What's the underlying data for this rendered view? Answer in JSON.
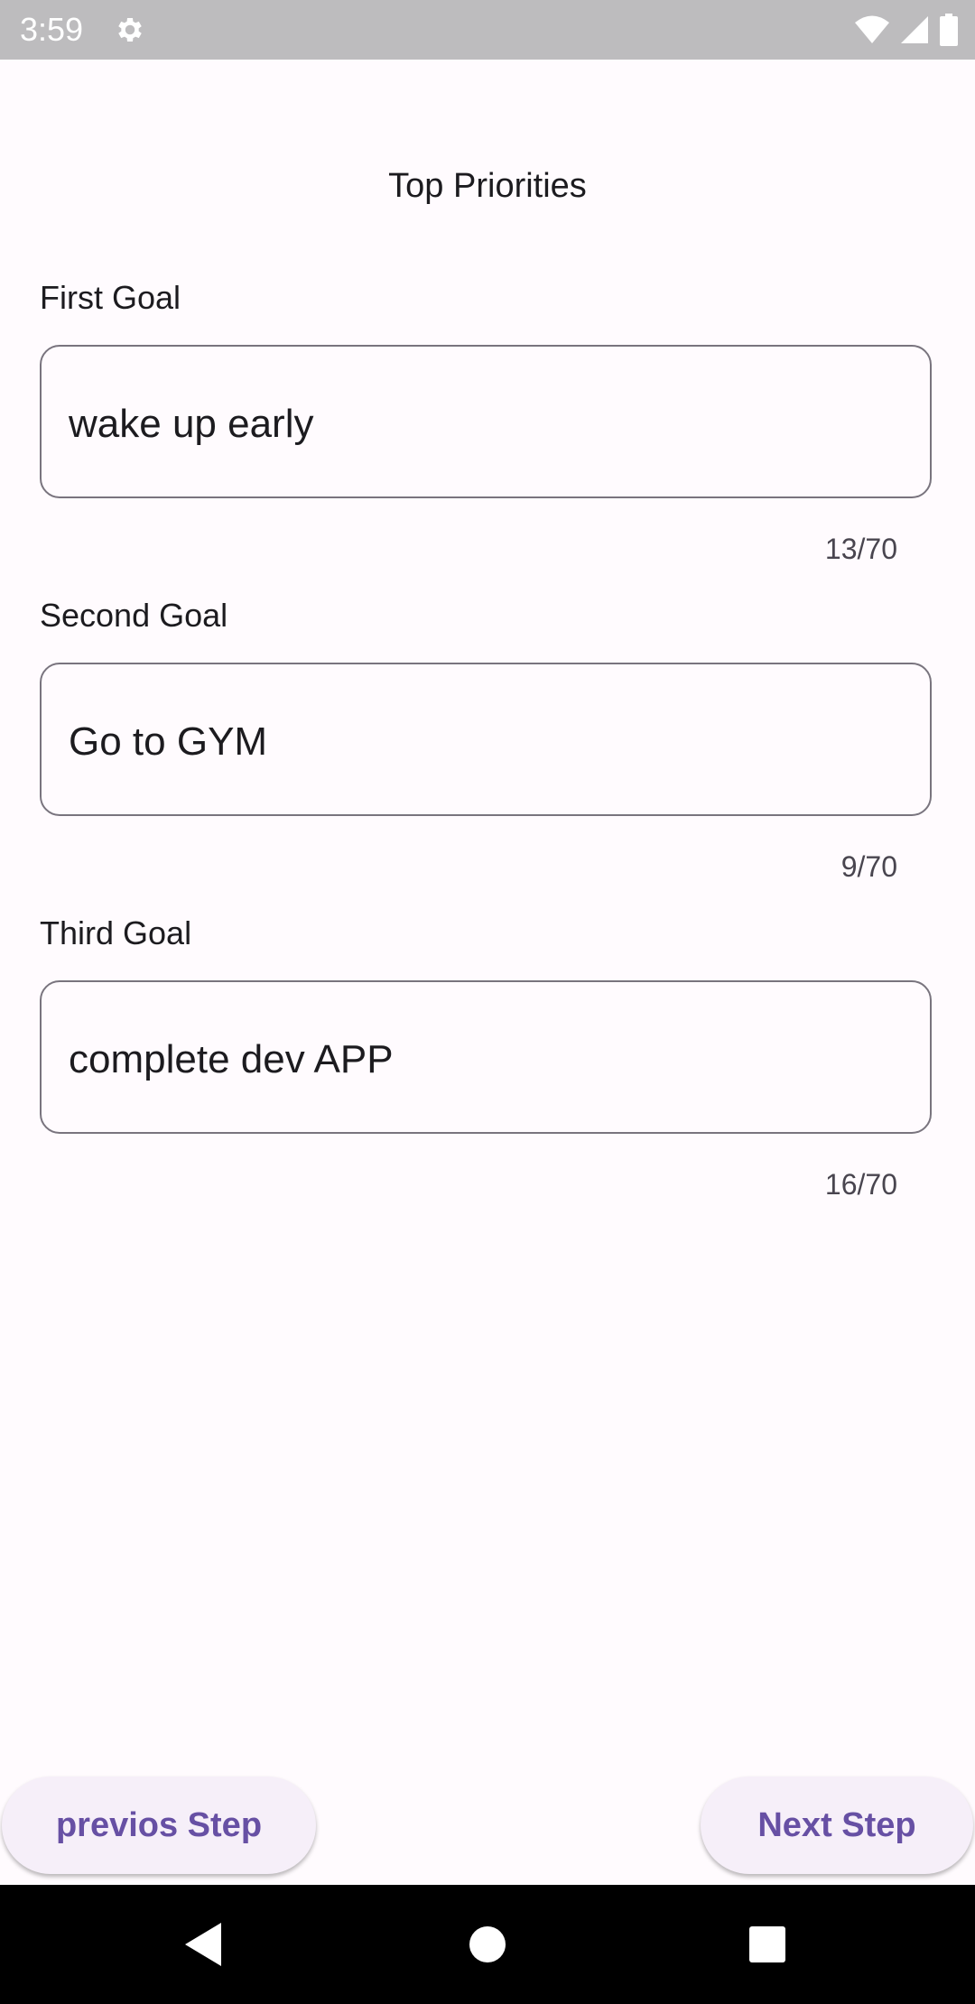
{
  "status_bar": {
    "time": "3:59",
    "icons": [
      "gear-icon",
      "wifi-icon",
      "signal-icon",
      "battery-icon"
    ]
  },
  "header": {
    "title": "Top Priorities"
  },
  "goals": [
    {
      "label": "First Goal",
      "value": "wake up early",
      "counter": "13/70"
    },
    {
      "label": "Second Goal",
      "value": "Go to GYM",
      "counter": "9/70"
    },
    {
      "label": "Third Goal",
      "value": "complete dev APP",
      "counter": "16/70"
    }
  ],
  "footer": {
    "prev_label": "previos Step",
    "next_label": "Next Step"
  },
  "colors": {
    "accent": "#6750a4",
    "background": "#fffbfe",
    "outline": "#79747e",
    "button_bg": "#f6eff9"
  },
  "nav_bar": {
    "icons": [
      "back-icon",
      "home-icon",
      "recents-icon"
    ]
  }
}
